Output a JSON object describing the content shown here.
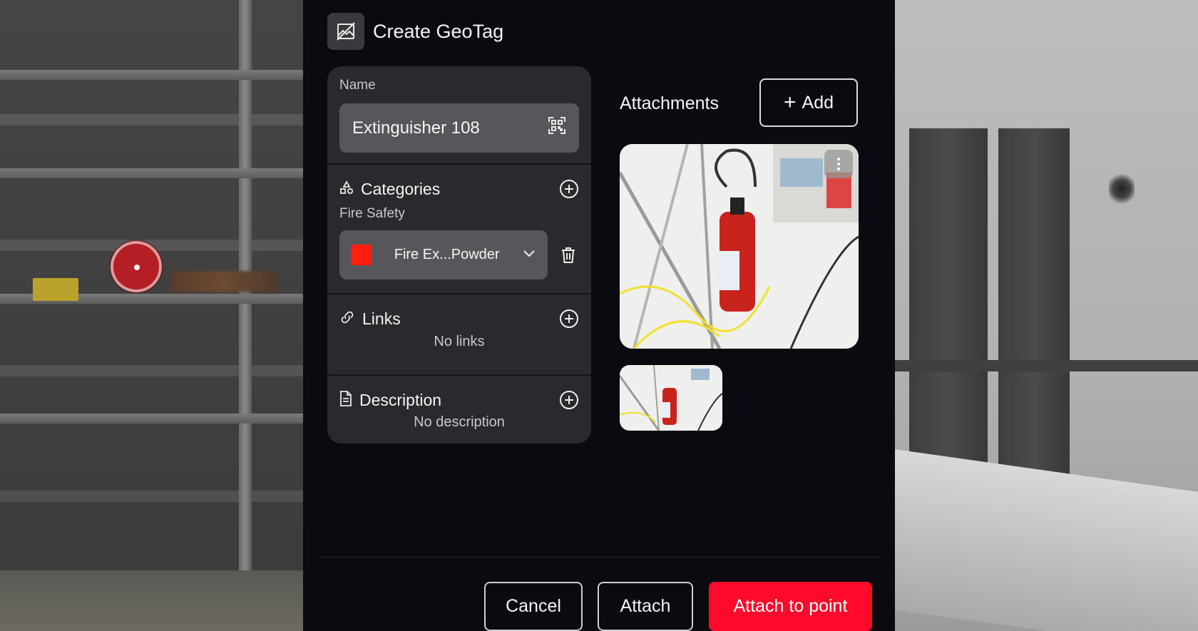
{
  "header": {
    "title": "Create GeoTag",
    "icon": "image-off-icon"
  },
  "name_field": {
    "label": "Name",
    "value": "Extinguisher 108",
    "icon": "qr-scan-icon"
  },
  "categories": {
    "label": "Categories",
    "icon": "shapes-icon",
    "group_label": "Fire Safety",
    "selected": {
      "label": "Fire Ex...Powder",
      "color": "#ff1e10"
    }
  },
  "links": {
    "label": "Links",
    "icon": "link-icon",
    "empty": "No links"
  },
  "description": {
    "label": "Description",
    "icon": "document-icon",
    "empty": "No description"
  },
  "attachments": {
    "title": "Attachments",
    "add_label": "Add",
    "add_symbol": "+",
    "items": [
      {
        "type": "photo",
        "subject": "red fire extinguisher mounted on wall"
      }
    ]
  },
  "footer": {
    "cancel_label": "Cancel",
    "attach_label": "Attach",
    "attach_point_label": "Attach to point",
    "primary_color": "#ff0a2c"
  }
}
